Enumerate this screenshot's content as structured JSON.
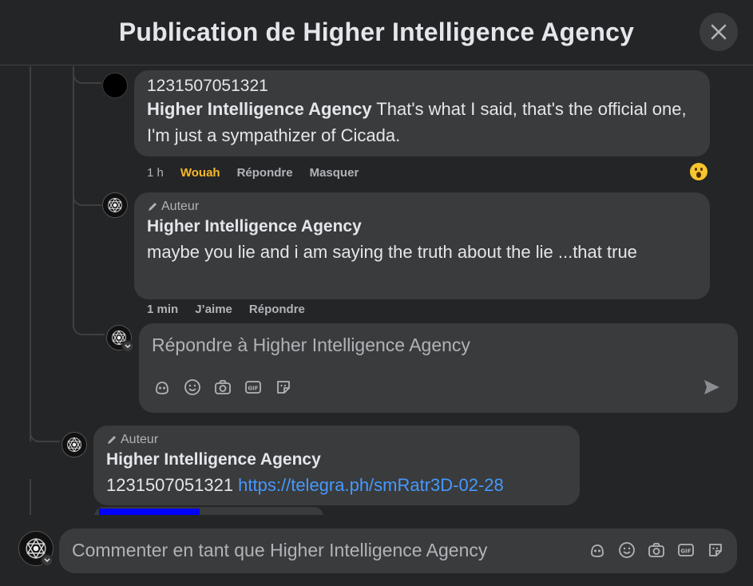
{
  "header": {
    "title": "Publication de Higher Intelligence Agency"
  },
  "comments": [
    {
      "name": "1231507051321",
      "mention": "Higher Intelligence Agency",
      "text": " That's what I said, that's the official one, I'm just a sympathizer of Cicada.",
      "time": "1 h",
      "reaction_label": "Wouah",
      "reply_label": "Répondre",
      "hide_label": "Masquer",
      "reaction_icon": "wow-emoji"
    },
    {
      "badge": "Auteur",
      "name": "Higher Intelligence Agency",
      "text": "maybe you lie and i am saying the truth about the lie ...that true",
      "time": "1 min",
      "like_label": "J’aime",
      "reply_label": "Répondre"
    },
    {
      "badge": "Auteur",
      "name": "Higher Intelligence Agency",
      "text_prefix": "1231507051321 ",
      "link": "https://telegra.ph/smRatr3D-02-28"
    }
  ],
  "reply_box": {
    "placeholder": "Répondre à Higher Intelligence Agency"
  },
  "footer": {
    "placeholder": "Commenter en tant que Higher Intelligence Agency"
  },
  "icons": [
    "avatar-icon",
    "emoji-icon",
    "camera-icon",
    "gif-icon",
    "sticker-icon",
    "send-icon"
  ],
  "colors": {
    "background": "#242526",
    "bubble": "#3a3b3c",
    "link": "#4599ff",
    "reaction": "#f7b928"
  }
}
